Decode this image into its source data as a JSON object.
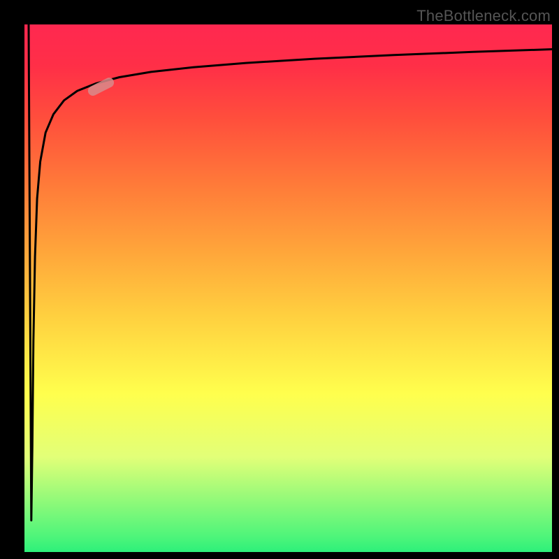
{
  "watermark": "TheBottleneck.com",
  "chart_data": {
    "type": "line",
    "title": "",
    "xlabel": "",
    "ylabel": "",
    "xlim": [
      0,
      100
    ],
    "ylim": [
      0,
      100
    ],
    "grid": false,
    "legend": false,
    "series": [
      {
        "name": "curve",
        "x": [
          0.8,
          1.3,
          1.5,
          1.7,
          2.0,
          2.4,
          3.0,
          4.0,
          5.5,
          7.5,
          10.0,
          13.5,
          18.0,
          24.0,
          32.0,
          42.0,
          55.0,
          70.0,
          85.0,
          100.0
        ],
        "y": [
          100.0,
          6.0,
          20.0,
          40.0,
          56.0,
          67.0,
          74.0,
          79.5,
          83.0,
          85.6,
          87.4,
          88.8,
          90.0,
          91.0,
          91.9,
          92.7,
          93.5,
          94.2,
          94.8,
          95.3
        ]
      }
    ],
    "highlight": {
      "name": "marker-pill",
      "x_center": 14.5,
      "y_center": 88.2,
      "color": "#d98b8b"
    }
  }
}
